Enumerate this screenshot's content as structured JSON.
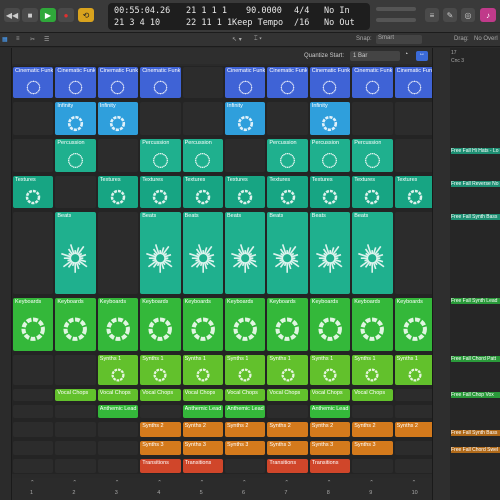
{
  "lcd": {
    "position_time": "00:55:04.26",
    "position_bars": "21 1 1 1",
    "sub_bars": "21 3 4 10",
    "sub_bars2": "22 11 1 1",
    "tempo": "90.0000",
    "tempo_mode": "Keep Tempo",
    "signature": "4/4",
    "division": "/16",
    "midi_in": "No In",
    "midi_out": "No Out"
  },
  "toolbar": {
    "snap_label": "Snap:",
    "snap_value": "Smart",
    "drag_label": "Drag:",
    "drag_value": "No Overl"
  },
  "header": {
    "quantize_label": "Quantize Start:",
    "quantize_value": "1 Bar"
  },
  "colors": {
    "blue": "#3f63d6",
    "lightblue": "#2f9fdc",
    "teal": "#1fb08e",
    "teal2": "#17a583",
    "green": "#34b83a",
    "lime": "#62c12c",
    "orange": "#d47a1c",
    "red": "#d0462a"
  },
  "rows": [
    {
      "cells": [
        "Cinematic Funk",
        "Cinematic Funk",
        "Cinematic Funk",
        "Cinematic Funk",
        "",
        "Cinematic Funk",
        "Cinematic Funk",
        "Cinematic Funk",
        "Cinematic Funk",
        "Cinematic Funk"
      ],
      "color": "blue",
      "icon": "ring-dots-icon"
    },
    {
      "cells": [
        "",
        "Infinity",
        "Infinity",
        "",
        "",
        "Infinity",
        "",
        "Infinity",
        "",
        ""
      ],
      "color": "lightblue",
      "icon": "ring-icon"
    },
    {
      "cells": [
        "",
        "Percussion",
        "",
        "Percussion",
        "Percussion",
        "",
        "Percussion",
        "Percussion",
        "Percussion",
        ""
      ],
      "color": "teal",
      "icon": "ring-dots-icon"
    },
    {
      "cells": [
        "Textures",
        "",
        "Textures",
        "Textures",
        "Textures",
        "Textures",
        "Textures",
        "Textures",
        "Textures",
        "Textures"
      ],
      "color": "teal2",
      "icon": "ring-icon"
    },
    {
      "cells": [
        "",
        "Beats",
        "",
        "Beats",
        "Beats",
        "Beats",
        "Beats",
        "Beats",
        "Beats",
        ""
      ],
      "color": "teal",
      "icon": "burst-icon"
    },
    {
      "cells": [
        "Keyboards",
        "Keyboards",
        "Keyboards",
        "Keyboards",
        "Keyboards",
        "Keyboards",
        "Keyboards",
        "Keyboards",
        "Keyboards",
        "Keyboards"
      ],
      "color": "green",
      "icon": "ring-icon"
    },
    {
      "cells": [
        "",
        "",
        "Synths 1",
        "Synths 1",
        "Synths 1",
        "Synths 1",
        "Synths 1",
        "Synths 1",
        "Synths 1",
        "Synths 1"
      ],
      "color": "lime",
      "icon": "ring-icon"
    },
    {
      "cells": [
        "",
        "Vocal Chops",
        "Vocal Chops",
        "Vocal Chops",
        "Vocal Chops",
        "Vocal Chops",
        "Vocal Chops",
        "Vocal Chops",
        "Vocal Chops",
        ""
      ],
      "color": "lime",
      "icon": "none"
    },
    {
      "cells": [
        "",
        "",
        "Anthemic Lead",
        "",
        "Anthemic Lead",
        "Anthemic Lead",
        "",
        "Anthemic Lead",
        "",
        ""
      ],
      "color": "green",
      "icon": "none"
    },
    {
      "cells": [
        "",
        "",
        "",
        "Synths 2",
        "Synths 2",
        "Synths 2",
        "Synths 2",
        "Synths 2",
        "Synths 2",
        "Synths 2"
      ],
      "color": "orange",
      "icon": "none"
    },
    {
      "cells": [
        "",
        "",
        "",
        "Synths 3",
        "Synths 3",
        "Synths 3",
        "Synths 3",
        "Synths 3",
        "Synths 3",
        ""
      ],
      "color": "orange",
      "icon": "none"
    },
    {
      "cells": [
        "",
        "",
        "",
        "Transitions",
        "Transitions",
        "",
        "Transitions",
        "Transitions",
        "",
        ""
      ],
      "color": "red",
      "icon": "none"
    }
  ],
  "scene_numbers": [
    "1",
    "2",
    "3",
    "4",
    "5",
    "6",
    "7",
    "8",
    "9",
    "10"
  ],
  "right_pane": {
    "bar_number": "17",
    "region_label": "Cnc 3",
    "items": [
      "Free Fall Hi Hats - Lo",
      "Free Fall Reverse No",
      "Free Fall Synth Bass",
      "Free Fall Synth Lead",
      "Free Fall Chord Patt",
      "Free Fall Chop Vox",
      "Free Fall Synth Bass",
      "Free Fall Chord Swel"
    ]
  }
}
